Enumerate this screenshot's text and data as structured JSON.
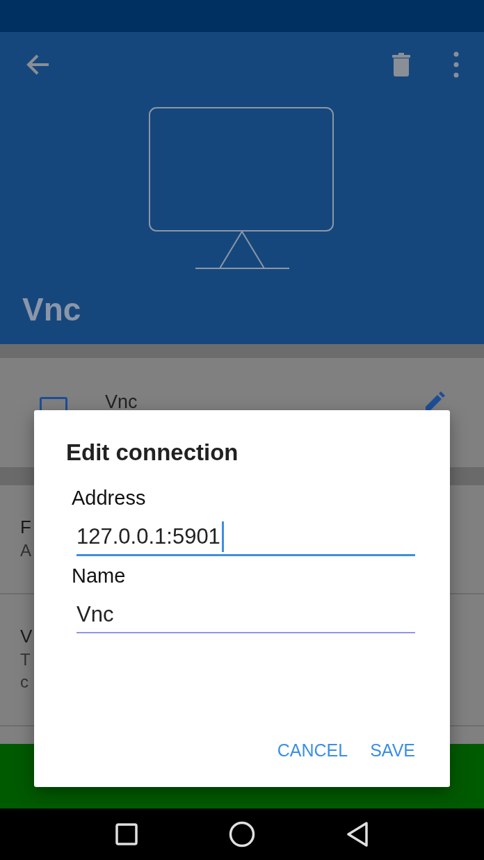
{
  "app_bar": {
    "title": "Vnc"
  },
  "connection_card": {
    "name": "Vnc"
  },
  "settings_rows": [
    {
      "title": "F",
      "subtitle_lines": [
        "A"
      ]
    },
    {
      "title": "V",
      "subtitle_lines": [
        "T",
        "c"
      ]
    }
  ],
  "dialog": {
    "title": "Edit connection",
    "fields": [
      {
        "label": "Address",
        "value": "127.0.0.1:5901",
        "focused": true
      },
      {
        "label": "Name",
        "value": "Vnc",
        "focused": false
      }
    ],
    "buttons": [
      "CANCEL",
      "SAVE"
    ]
  }
}
